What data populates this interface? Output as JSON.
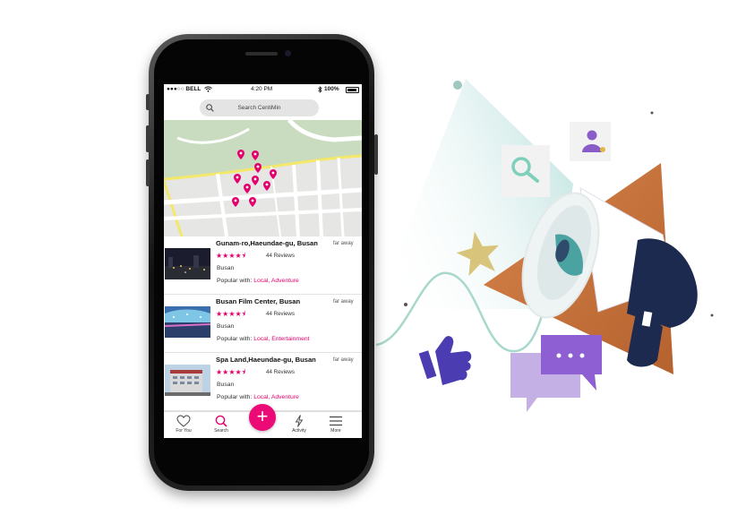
{
  "status_bar": {
    "carrier": "●●●○○ BELL",
    "time": "4:20 PM",
    "battery": "100%"
  },
  "search": {
    "placeholder": "Search CentiMin"
  },
  "listings": [
    {
      "title": "Gunam-ro,Haeundae-gu, Busan",
      "distance": "far away",
      "stars": "★★★★⯨",
      "reviews": "44 Reviews",
      "city": "Busan",
      "popular_prefix": "Popular with: ",
      "popular_tags": "Local, Adventure"
    },
    {
      "title": "Busan Film Center, Busan",
      "distance": "far away",
      "stars": "★★★★⯨",
      "reviews": "44 Reviews",
      "city": "Busan",
      "popular_prefix": "Popular with: ",
      "popular_tags": "Local, Entertainment"
    },
    {
      "title": "Spa Land,Haeundae-gu, Busan",
      "distance": "far away",
      "stars": "★★★★⯨",
      "reviews": "44 Reviews",
      "city": "Busan",
      "popular_prefix": "Popular with: ",
      "popular_tags": "Local, Adventure"
    }
  ],
  "tabbar": {
    "for_you": "For You",
    "search": "Search",
    "add": "+",
    "activity": "Activity",
    "more": "More"
  },
  "colors": {
    "accent": "#ec0a76",
    "map_park": "#c9dcc0",
    "road_yellow": "#f3e86a"
  },
  "icons": [
    "wifi-icon",
    "bluetooth-icon",
    "battery-icon",
    "search-icon",
    "map-pin-icon",
    "heart-icon",
    "bolt-icon",
    "menu-icon",
    "megaphone-icon",
    "thumbs-up-icon",
    "star-icon",
    "chat-bubble-icon",
    "user-icon"
  ]
}
